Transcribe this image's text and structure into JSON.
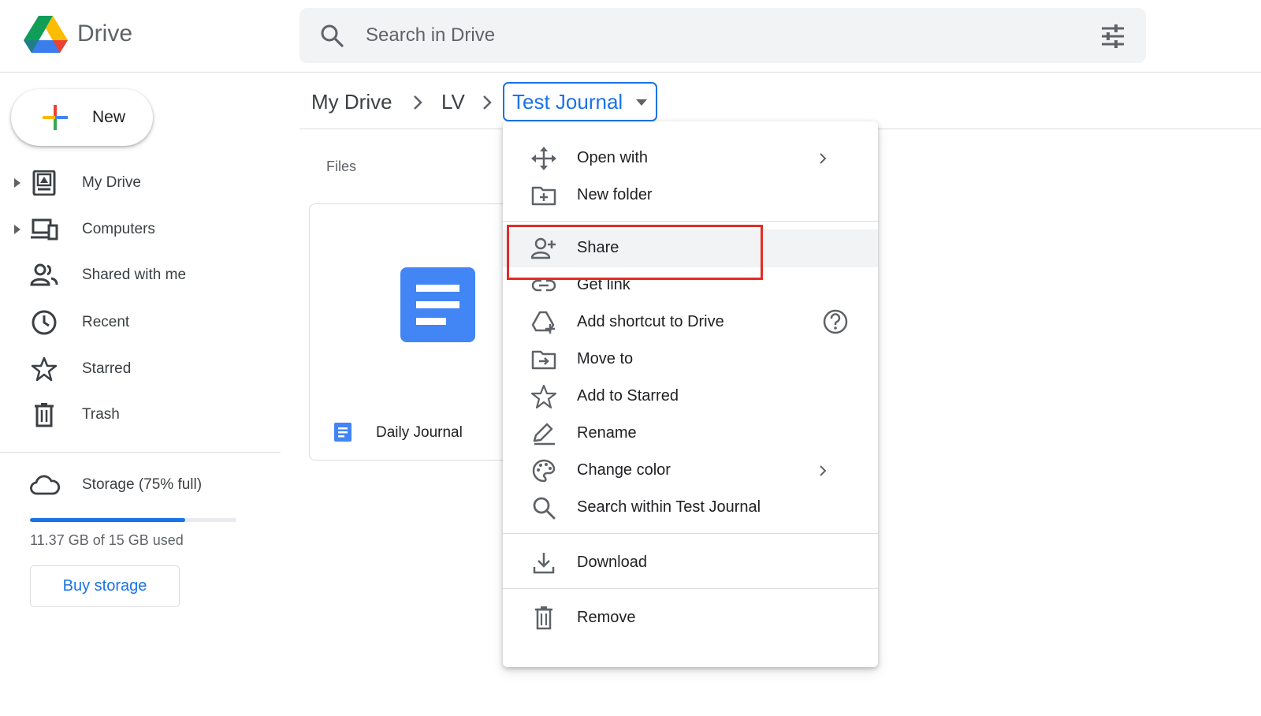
{
  "header": {
    "brand": "Drive",
    "search_placeholder": "Search in Drive"
  },
  "sidebar": {
    "new_label": "New",
    "items": [
      {
        "label": "My Drive",
        "icon": "my-drive-icon",
        "expandable": true
      },
      {
        "label": "Computers",
        "icon": "computers-icon",
        "expandable": true
      },
      {
        "label": "Shared with me",
        "icon": "shared-with-me-icon",
        "expandable": false
      },
      {
        "label": "Recent",
        "icon": "clock-icon",
        "expandable": false
      },
      {
        "label": "Starred",
        "icon": "star-icon",
        "expandable": false
      },
      {
        "label": "Trash",
        "icon": "trash-icon",
        "expandable": false
      }
    ],
    "storage": {
      "label": "Storage (75% full)",
      "used_fraction": 0.75,
      "usage_text": "11.37 GB of 15 GB used",
      "buy_label": "Buy storage"
    }
  },
  "breadcrumb": {
    "items": [
      "My Drive",
      "LV"
    ],
    "current": "Test Journal"
  },
  "files": {
    "section_label": "Files",
    "items": [
      {
        "name": "Daily Journal",
        "type": "google-doc"
      }
    ]
  },
  "context_menu": {
    "groups": [
      [
        {
          "label": "Open with",
          "icon": "open-with-icon",
          "submenu": true
        },
        {
          "label": "New folder",
          "icon": "new-folder-icon"
        }
      ],
      [
        {
          "label": "Share",
          "icon": "share-person-add-icon",
          "highlighted": true
        },
        {
          "label": "Get link",
          "icon": "link-icon"
        },
        {
          "label": "Add shortcut to Drive",
          "icon": "add-shortcut-icon",
          "help": true
        },
        {
          "label": "Move to",
          "icon": "move-to-folder-icon"
        },
        {
          "label": "Add to Starred",
          "icon": "star-icon"
        },
        {
          "label": "Rename",
          "icon": "rename-pencil-icon"
        },
        {
          "label": "Change color",
          "icon": "palette-icon",
          "submenu": true
        },
        {
          "label": "Search within Test Journal",
          "icon": "search-icon"
        }
      ],
      [
        {
          "label": "Download",
          "icon": "download-icon"
        }
      ],
      [
        {
          "label": "Remove",
          "icon": "trash-icon"
        }
      ]
    ]
  },
  "colors": {
    "accent": "#1a73e8",
    "highlight_box": "#e32b25",
    "hover_bg": "#f1f3f4"
  }
}
